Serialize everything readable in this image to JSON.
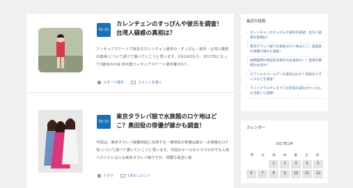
{
  "articles": [
    {
      "date": "02.15",
      "title": "カレンチェンのすっぴんや彼氏を調査！台湾人疑惑の真相は？",
      "excerpt": "フィギュアスケートで有名なカレンチェン選手の・すっぴん・彼氏・台湾人疑惑の真相 について調べて書いていこうと思います。2月16日から、2017年になって3度目の大会 四大陸フィギュアスケート選手権2017...",
      "category": "スポーツ選手",
      "comments": "コメントを書く"
    },
    {
      "date": "02.15",
      "title": "東京タラレバ娘で水族館のロケ地はどこ？奥田役の俳優が誰かも調査！",
      "excerpt": "今回は、東京タラレバ娘第四話に出演する・奥田役の俳優は誰か・水族館のロケ地 について調べて書いていこうと思います。今回のキールのドラマの中でも人気ベスト3 には入る東京タラレバ娘ですが、残酷な毒舌に後",
      "category": "ドラマ",
      "comments": "1件のコメント"
    }
  ],
  "sidebar": {
    "recent_title": "最近の投稿",
    "recent_posts": [
      "カレンチェンのすっぴんや彼氏を調査！台湾人疑惑の真相は？",
      "東京タラレバ娘で水族館のロケ地はどこ？奥田役の俳優が誰かも調査！",
      "福岡國際の原田宗洋選手のお金持ち！？愛用の腕時計は何か？",
      "カブリエルゴールデンの彼氏はだれ？得意のスタイルなどを調査！",
      "ライトグラスやシモラブの音楽の彼氏がすっぴんも可愛いと話題！"
    ],
    "calendar_title": "カレンダー",
    "calendar_caption": "2017年2月",
    "calendar_headers": [
      "月",
      "火",
      "水",
      "木",
      "金",
      "土",
      "日"
    ],
    "calendar_row1": [
      "",
      "",
      "1",
      "2",
      "3",
      "4",
      "5"
    ],
    "calendar_row2": [
      "6",
      "7",
      "8",
      "9",
      "10",
      "11",
      "12"
    ]
  },
  "colors": {
    "accent": "#1b6fb3",
    "background": "#f0f0f0"
  }
}
